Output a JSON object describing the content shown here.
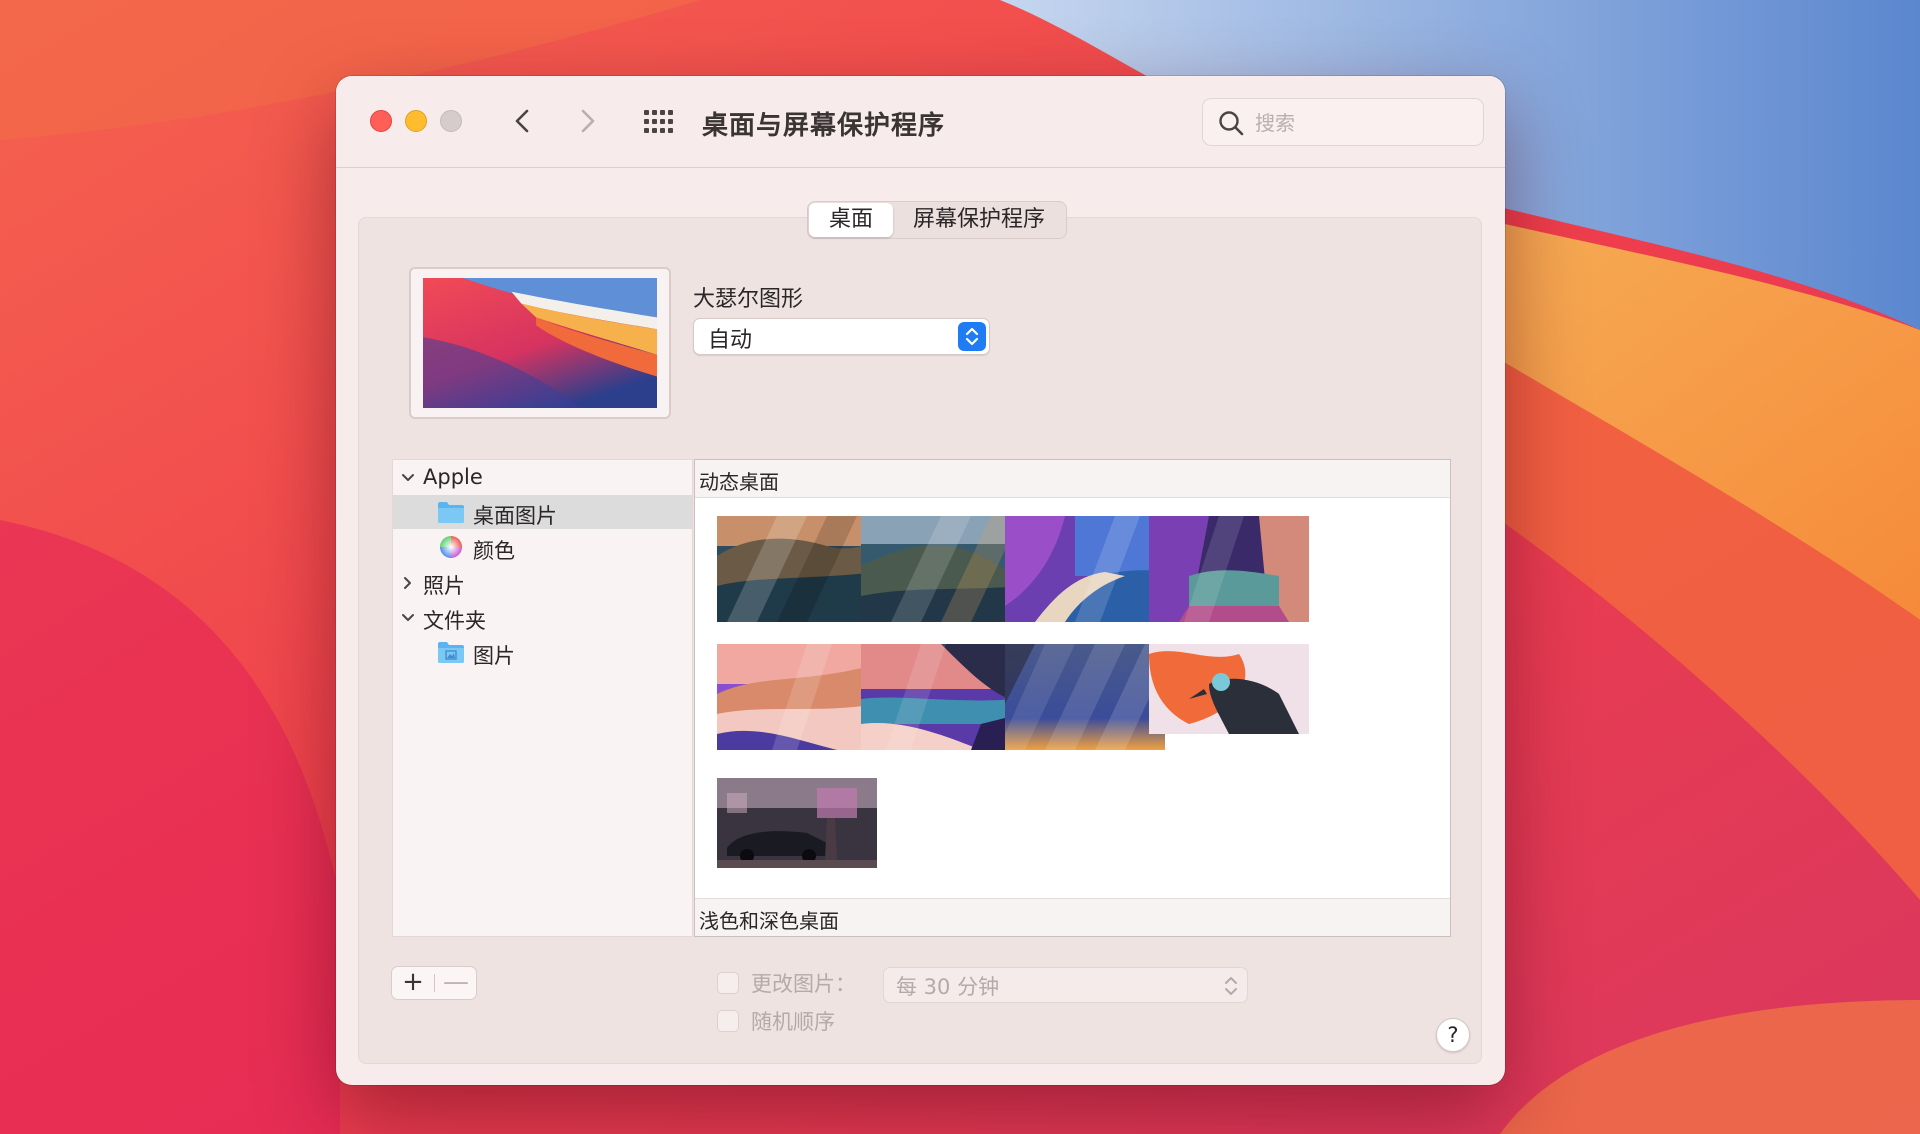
{
  "window": {
    "title": "桌面与屏幕保护程序",
    "search_placeholder": "搜索"
  },
  "tabs": [
    {
      "label": "桌面",
      "active": true
    },
    {
      "label": "屏幕保护程序",
      "active": false
    }
  ],
  "current": {
    "wallpaper_name": "大瑟尔图形",
    "appearance": "自动"
  },
  "sidebar": {
    "items": [
      {
        "label": "Apple",
        "type": "group",
        "expanded": true
      },
      {
        "label": "桌面图片",
        "type": "folder",
        "selected": true
      },
      {
        "label": "颜色",
        "type": "colors"
      },
      {
        "label": "照片",
        "type": "group",
        "expanded": false
      },
      {
        "label": "文件夹",
        "type": "group",
        "expanded": true
      },
      {
        "label": "图片",
        "type": "pictures-folder"
      }
    ]
  },
  "gallery": {
    "section_top": "动态桌面",
    "section_bottom": "浅色和深色桌面",
    "thumbnails": [
      {
        "name": "catalina-day-thumbnail"
      },
      {
        "name": "catalina-island-thumbnail"
      },
      {
        "name": "big-sur-coast-purple-thumbnail"
      },
      {
        "name": "big-sur-valley-thumbnail"
      },
      {
        "name": "big-sur-dunes-thumbnail"
      },
      {
        "name": "big-sur-shore-thumbnail"
      },
      {
        "name": "blue-gradient-thumbnail"
      },
      {
        "name": "orange-bird-thumbnail"
      },
      {
        "name": "cyberpunk-car-thumbnail"
      }
    ]
  },
  "options": {
    "change_picture_label": "更改图片：",
    "change_interval": "每 30 分钟",
    "random_order_label": "随机顺序",
    "change_picture_checked": false,
    "random_order_checked": false
  },
  "buttons": {
    "add": "+",
    "remove": "—",
    "help": "?"
  },
  "colors": {
    "accent": "#1f7cf5",
    "selected_row": "#dcdcdc"
  }
}
